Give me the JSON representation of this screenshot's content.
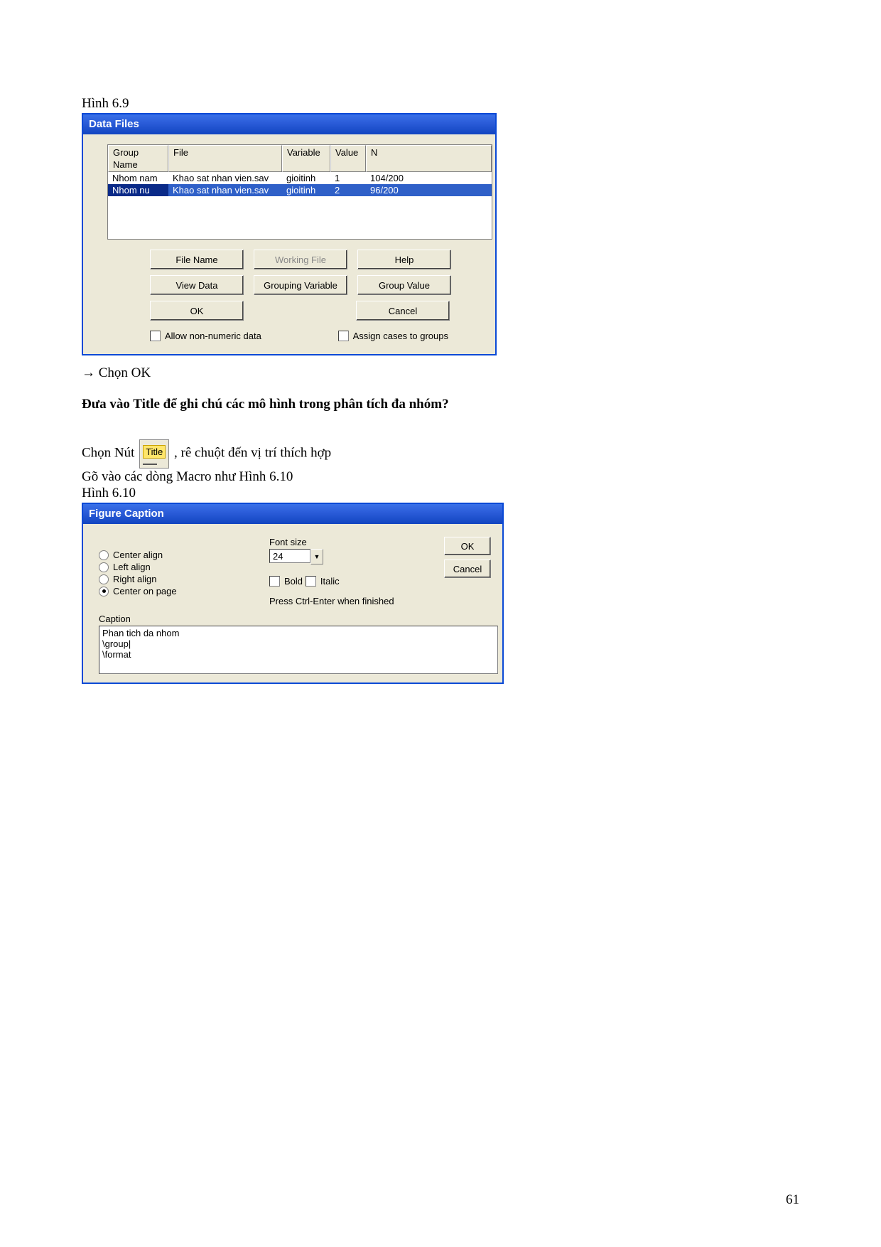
{
  "figure1_label": "Hình 6.9",
  "dialog1": {
    "title": "Data Files",
    "columns": {
      "group": "Group Name",
      "file": "File",
      "variable": "Variable",
      "value": "Value",
      "n": "N"
    },
    "rows": [
      {
        "group": "Nhom nam",
        "file": "Khao sat nhan vien.sav",
        "variable": "gioitinh",
        "value": "1",
        "n": "104/200",
        "selected": false
      },
      {
        "group": "Nhom nu",
        "file": "Khao sat nhan vien.sav",
        "variable": "gioitinh",
        "value": "2",
        "n": "96/200",
        "selected": true
      }
    ],
    "buttons": {
      "file_name": "File Name",
      "working_file": "Working File",
      "help": "Help",
      "view_data": "View Data",
      "grouping_variable": "Grouping Variable",
      "group_value": "Group Value",
      "ok": "OK",
      "cancel": "Cancel"
    },
    "checks": {
      "allow_non_numeric": "Allow non-numeric data",
      "assign_cases": "Assign cases to groups"
    }
  },
  "instr_arrow": "→ Chọn OK",
  "question_text": "Đưa vào Title để ghi chú các mô hình trong phân tích đa nhóm?",
  "body": {
    "line1_pre": "Chọn Nút ",
    "title_icon_text": "Title",
    "line1_post": ", rê chuột đến vị trí thích hợp",
    "line2": "Gõ vào các dòng Macro như Hình 6.10"
  },
  "figure2_label": "Hình 6.10",
  "dialog2": {
    "title": "Figure Caption",
    "align": {
      "center": "Center align",
      "left": "Left align",
      "right": "Right align",
      "page": "Center on page"
    },
    "font_size_label": "Font size",
    "font_size_value": "24",
    "bold": "Bold",
    "italic": "Italic",
    "hint": "Press Ctrl-Enter when finished",
    "ok": "OK",
    "cancel": "Cancel",
    "caption_label": "Caption",
    "caption_text": "Phan tich da nhom\n\\group|\n\\format"
  },
  "page_number": "61"
}
